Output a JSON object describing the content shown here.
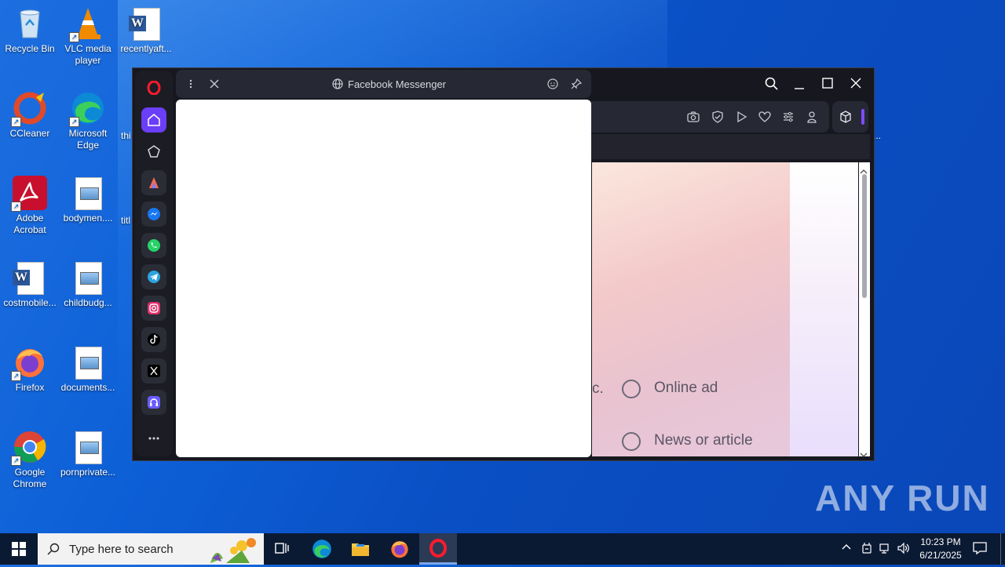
{
  "desktop": {
    "icons": [
      {
        "label": "Recycle Bin"
      },
      {
        "label": "VLC media player"
      },
      {
        "label": "recentlyaft..."
      },
      {
        "label": "CCleaner"
      },
      {
        "label": "Microsoft Edge"
      },
      {
        "label": "Adobe Acrobat"
      },
      {
        "label": "bodymen...."
      },
      {
        "label": "costmobile..."
      },
      {
        "label": "childbudg..."
      },
      {
        "label": "Firefox"
      },
      {
        "label": "documents..."
      },
      {
        "label": "Google Chrome"
      },
      {
        "label": "pornprivate..."
      }
    ],
    "partial_labels": [
      "thi",
      "titl"
    ],
    "partial_right": "..."
  },
  "browser": {
    "panel_title": "Facebook Messenger",
    "content": {
      "partial_text": "c.",
      "options": [
        {
          "label": "Online ad"
        },
        {
          "label": "News or article"
        }
      ]
    }
  },
  "sidebar": {
    "items": [
      "opera-logo",
      "home",
      "bookmarks",
      "aria",
      "messenger",
      "whatsapp",
      "telegram",
      "instagram",
      "tiktok",
      "x",
      "music",
      "more"
    ]
  },
  "taskbar": {
    "search_placeholder": "Type here to search",
    "time": "10:23 PM",
    "date": "6/21/2025"
  },
  "watermark": "ANY RUN"
}
